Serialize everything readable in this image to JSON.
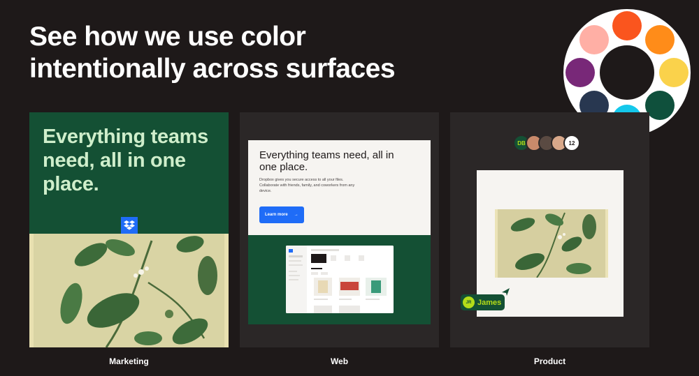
{
  "headline": {
    "line1": "See how we use color",
    "line2": "intentionally across surfaces"
  },
  "palette": [
    {
      "name": "orange-red",
      "hex": "#fa551e"
    },
    {
      "name": "orange",
      "hex": "#ff8c19"
    },
    {
      "name": "yellow",
      "hex": "#fad24b"
    },
    {
      "name": "dark-green",
      "hex": "#0f503c"
    },
    {
      "name": "cyan",
      "hex": "#14c8eb"
    },
    {
      "name": "navy",
      "hex": "#283750"
    },
    {
      "name": "purple",
      "hex": "#782878"
    },
    {
      "name": "pink",
      "hex": "#ffafa5"
    }
  ],
  "marketing": {
    "title": "Everything teams need, all in one place.",
    "caption": "Marketing"
  },
  "web": {
    "title": "Everything teams need, all in one place.",
    "body": "Dropbox gives you secure access to all your files. Collaborate with friends, family, and coworkers from any device.",
    "button": "Learn more",
    "caption": "Web"
  },
  "product": {
    "avatars": [
      {
        "initials": "DB",
        "bg": "#145034",
        "fg": "#b4dc19"
      },
      {
        "initials": "",
        "bg": "#c98a6b"
      },
      {
        "initials": "",
        "bg": "#5a4a42"
      },
      {
        "initials": "",
        "bg": "#d8a88a"
      }
    ],
    "more_count": "12",
    "cursor_initials": "JR",
    "cursor_name": "James",
    "caption": "Product"
  },
  "colors": {
    "background": "#1e1919",
    "green": "#145034",
    "blue": "#1f6cf7",
    "lime": "#b4dc19",
    "light_green_text": "#cfeecb"
  }
}
